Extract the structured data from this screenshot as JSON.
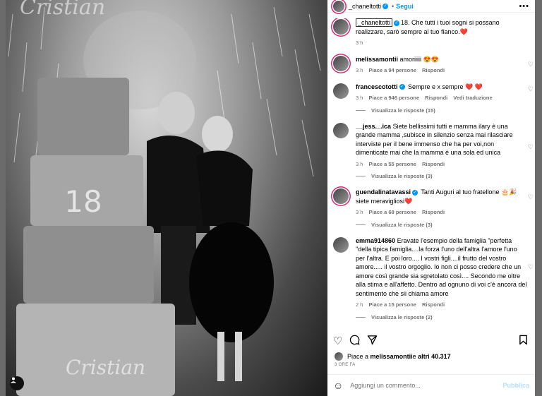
{
  "post": {
    "author": "_chaneltotti",
    "follow_label": "Segui",
    "more_label": "•••",
    "photo_script_text": "Cristian",
    "photo_cake_number": "18"
  },
  "comments": [
    {
      "user": "_chaneltotti",
      "verified": true,
      "text": "18. Che tutti i tuoi sogni si possano realizzare, sarò sempre al tuo fianco.❤️",
      "time": "3 h",
      "likes": "",
      "reply": "",
      "view_replies": "",
      "extra": ""
    },
    {
      "user": "melissamontii",
      "verified": false,
      "text": "amoriiiii 😍😍",
      "time": "3 h",
      "likes": "Piace a 94 persone",
      "reply": "Rispondi",
      "view_replies": "",
      "extra": ""
    },
    {
      "user": "francescototti",
      "verified": true,
      "text": "Sempre e x sempre ❤️ ❤️",
      "time": "3 h",
      "likes": "Piace a 946 persone",
      "reply": "Rispondi",
      "view_replies": "Visualizza le risposte (15)",
      "extra": "Vedi traduzione"
    },
    {
      "user": "__jess._.ica",
      "verified": false,
      "text": "Siete bellissimi tutti e mamma ilary è una grande mamma ,subisce in silenzio senza mai rilasciare interviste per il bene immenso che ha per voi,non dimenticate mai che la mamma è una sola ed unica",
      "time": "3 h",
      "likes": "Piace a 55 persone",
      "reply": "Rispondi",
      "view_replies": "Visualizza le risposte (3)",
      "extra": ""
    },
    {
      "user": "guendalinatavassi",
      "verified": true,
      "text": "Tanti Auguri al tuo fratellone 🎂🎉 siete meravigliosi❤️",
      "time": "3 h",
      "likes": "Piace a 68 persone",
      "reply": "Rispondi",
      "view_replies": "Visualizza le risposte (3)",
      "extra": ""
    },
    {
      "user": "emma914860",
      "verified": false,
      "text": "Eravate l'esempio della famiglia \"perfetta \"della tipica famiglia....la forza l'uno dell'altra l'amore l'uno per l'altra. E poi loro.... I vostri figli....il frutto del vostro amore..... il vostro orgoglio. Io non ci posso credere che un amore così grande sia sgretolato così.... Secondo me oltre alla stima e all'affetto. Dentro ad ognuno di voi c'è ancora del sentimento che sii chiama amore",
      "time": "2 h",
      "likes": "Piace a 15 persone",
      "reply": "Rispondi",
      "view_replies": "Visualizza le risposte (2)",
      "extra": ""
    }
  ],
  "likes_line": {
    "prefix": "Piace a ",
    "user": "melissamontii",
    "middle": " e ",
    "count": "altri 40.317"
  },
  "date": "3 ORE FA",
  "composer": {
    "placeholder": "Aggiungi un commento...",
    "publish_label": "Pubblica"
  },
  "icons": {
    "like": "heart-icon",
    "comment": "comment-icon",
    "share": "share-icon",
    "save": "bookmark-icon",
    "emoji": "emoji-icon"
  }
}
